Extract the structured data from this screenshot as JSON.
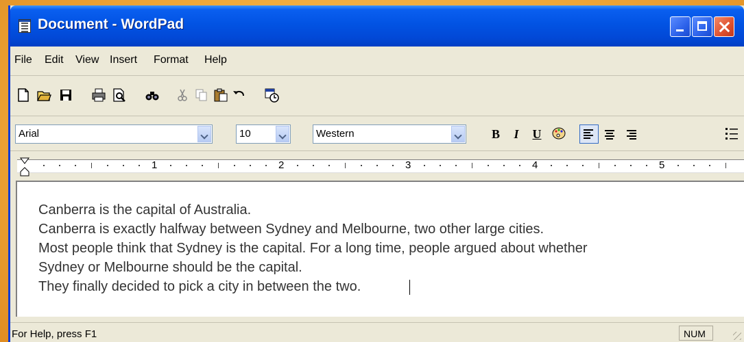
{
  "window": {
    "title": "Document - WordPad"
  },
  "menu": [
    "File",
    "Edit",
    "View",
    "Insert",
    "Format",
    "Help"
  ],
  "toolbar": {
    "icons": [
      "new-icon",
      "open-icon",
      "save-icon",
      "print-icon",
      "print-preview-icon",
      "find-icon",
      "cut-icon",
      "copy-icon",
      "paste-icon",
      "undo-icon",
      "date-time-icon"
    ]
  },
  "format": {
    "font": "Arial",
    "size": "10",
    "script": "Western",
    "bold": "B",
    "italic": "I",
    "underline": "U"
  },
  "ruler": {
    "numbers": [
      "1",
      "2",
      "3",
      "4",
      "5"
    ]
  },
  "document": {
    "lines": [
      "Canberra is the capital of Australia.",
      "Canberra is exactly halfway between Sydney and Melbourne, two other large cities.",
      "Most people think that Sydney is the capital.  For a long time, people argued about whether",
      "Sydney or Melbourne should be the capital.",
      "They finally decided to pick a city in between the two."
    ]
  },
  "status": {
    "help": "For Help, press F1",
    "num": "NUM"
  },
  "colors": {
    "titlebar": "#0253e3",
    "background": "#f0a93a",
    "chrome": "#ece9d8"
  }
}
